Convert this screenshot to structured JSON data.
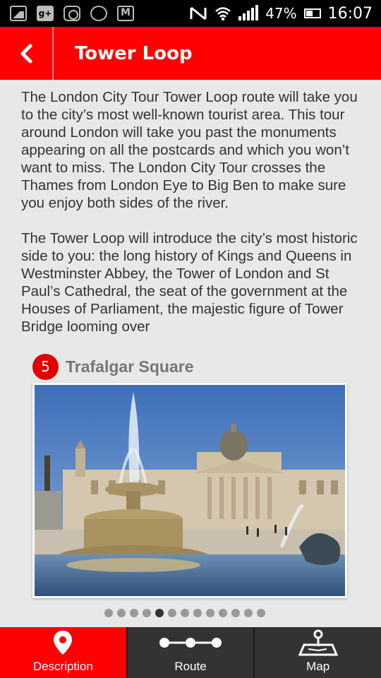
{
  "status_bar": {
    "left_icons": [
      "gallery-icon",
      "google-plus-icon",
      "instagram-icon",
      "whatsapp-icon",
      "gmail-icon"
    ],
    "right_icons": [
      "nfc-icon",
      "wifi-icon",
      "signal-icon",
      "battery-icon"
    ],
    "battery": "47%",
    "time": "16:07"
  },
  "header": {
    "back_icon": "chevron-left-icon",
    "title": "Tower Loop",
    "color": "#ff0000"
  },
  "description": {
    "paragraphs": [
      "The London City Tour Tower Loop route will take you to the city’s most well-known tourist area. This tour around London will take you past the monuments appearing on all the postcards and which you won’t want to miss.  The London City Tour crosses the Thames from London Eye to Big Ben to make sure you enjoy both sides of the river.",
      "The Tower Loop will introduce the city’s most historic side to you: the long history of Kings and Queens in Westminster Abbey, the Tower of London and St Paul’s Cathedral, the seat of the government at the Houses of Parliament, the majestic figure of Tower Bridge looming over"
    ]
  },
  "slide": {
    "number": "5",
    "title": "Trafalgar Square",
    "image": "trafalgar-square-photo",
    "dots_total": 13,
    "active_dot_index": 4
  },
  "bottom_nav": {
    "items": [
      {
        "label": "Description",
        "icon": "location-pin-icon",
        "active": true
      },
      {
        "label": "Route",
        "icon": "route-icon",
        "active": false
      },
      {
        "label": "Map",
        "icon": "map-icon",
        "active": false
      }
    ]
  }
}
